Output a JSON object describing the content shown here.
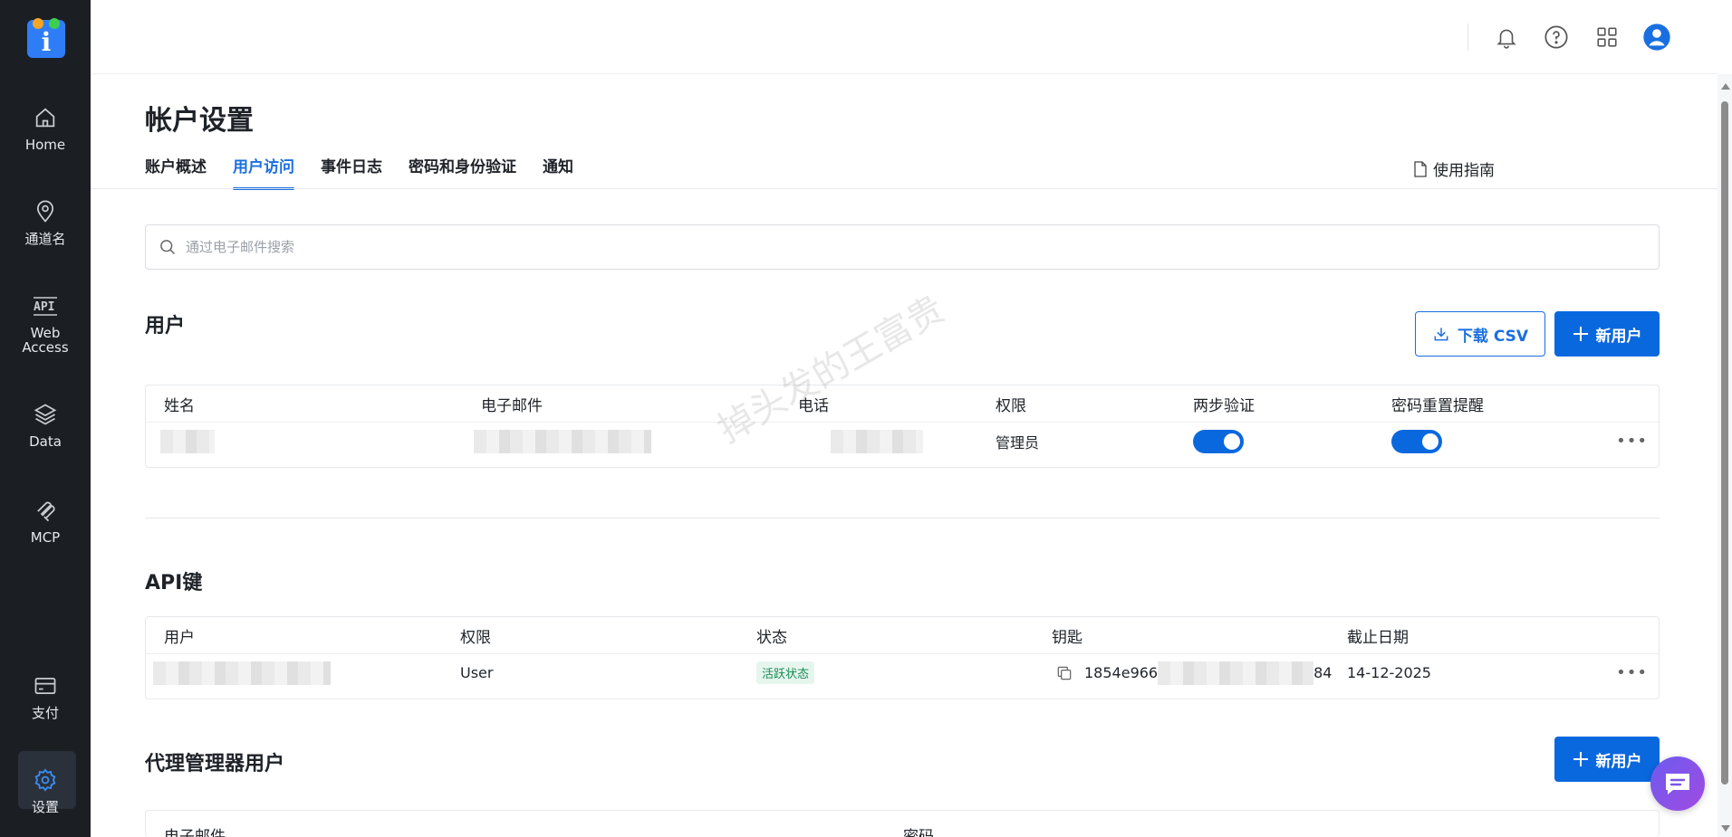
{
  "sidebar": {
    "items": [
      {
        "label": "Home",
        "icon": "home-icon"
      },
      {
        "label": "通道名",
        "icon": "location-pin-icon"
      },
      {
        "label": "Web\nAccess",
        "label_line1": "Web",
        "label_line2": "Access",
        "icon": "api-icon"
      },
      {
        "label": "Data",
        "icon": "layers-icon"
      },
      {
        "label": "MCP",
        "icon": "mcp-icon"
      },
      {
        "label": "支付",
        "icon": "card-icon"
      },
      {
        "label": "设置",
        "icon": "gear-icon"
      }
    ],
    "active": "设置"
  },
  "page": {
    "title": "帐户设置",
    "tabs": [
      "账户概述",
      "用户访问",
      "事件日志",
      "密码和身份验证",
      "通知"
    ],
    "active_tab": "用户访问",
    "guide_label": "使用指南"
  },
  "search": {
    "placeholder": "通过电子邮件搜索"
  },
  "users": {
    "title": "用户",
    "download_label": "下载 CSV",
    "new_label": "新用户",
    "columns": [
      "姓名",
      "电子邮件",
      "电话",
      "权限",
      "两步验证",
      "密码重置提醒"
    ],
    "rows": [
      {
        "permission": "管理员",
        "two_factor": true,
        "reset_reminder": true
      }
    ]
  },
  "api_keys": {
    "title": "API键",
    "columns": [
      "用户",
      "权限",
      "状态",
      "钥匙",
      "截止日期"
    ],
    "rows": [
      {
        "permission": "User",
        "status": "活跃状态",
        "key_prefix": "1854e966",
        "key_suffix": "84",
        "expiry": "14-12-2025"
      }
    ]
  },
  "proxy_users": {
    "title": "代理管理器用户",
    "new_label": "新用户",
    "columns": [
      "电子邮件",
      "密码"
    ]
  },
  "watermark": "掉头发的王富贵",
  "colors": {
    "accent": "#0a68df",
    "sidebar_bg": "#1b1f24",
    "badge_bg": "#e6f6ee",
    "badge_text": "#1a8a55"
  }
}
